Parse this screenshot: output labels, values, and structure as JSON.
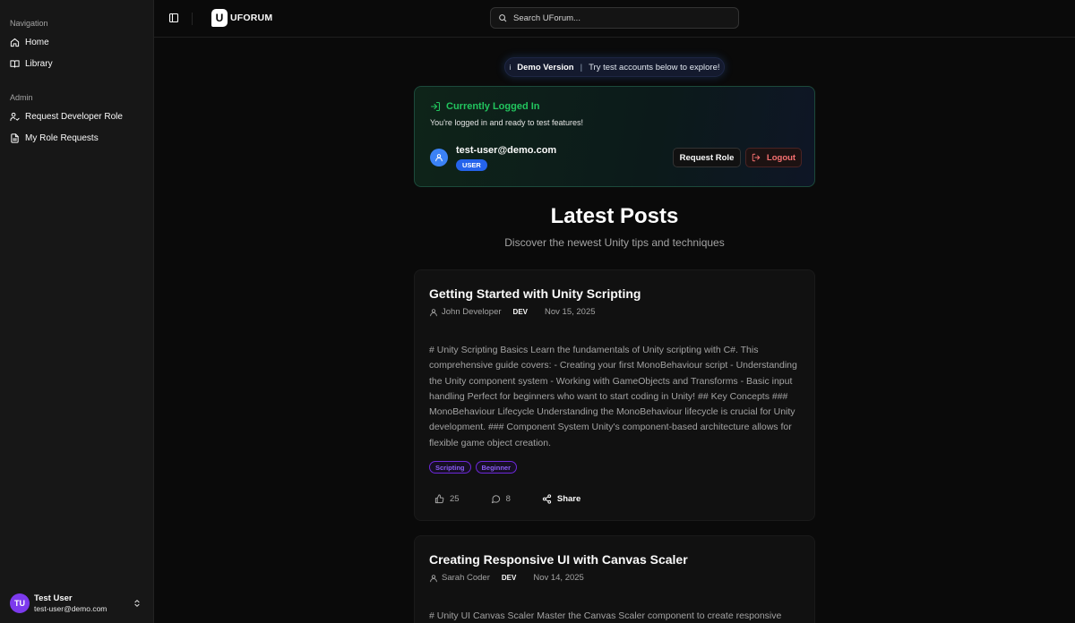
{
  "sidebar": {
    "nav_title": "Navigation",
    "nav_items": [
      {
        "label": "Home",
        "icon": "home-icon"
      },
      {
        "label": "Library",
        "icon": "book-icon"
      }
    ],
    "admin_title": "Admin",
    "admin_items": [
      {
        "label": "Request Developer Role",
        "icon": "user-check-icon"
      },
      {
        "label": "My Role Requests",
        "icon": "document-icon"
      }
    ],
    "user": {
      "initials": "TU",
      "name": "Test User",
      "email": "test-user@demo.com"
    }
  },
  "topbar": {
    "logo_mark": "U",
    "logo_text": "UFORUM",
    "search_placeholder": "Search UForum..."
  },
  "demo_banner": {
    "icon": "i",
    "title": "Demo Version",
    "separator": "|",
    "text": "Try test accounts below to explore!"
  },
  "login_card": {
    "title": "Currently Logged In",
    "subtitle": "You're logged in and ready to test features!",
    "email": "test-user@demo.com",
    "role": "USER",
    "request_role_label": "Request Role",
    "logout_label": "Logout",
    "colors": {
      "accent": "#22c55e",
      "logout": "#f87171",
      "badge": "#2563eb"
    }
  },
  "posts_section": {
    "title": "Latest Posts",
    "subtitle": "Discover the newest Unity tips and techniques"
  },
  "posts": [
    {
      "title": "Getting Started with Unity Scripting",
      "author": "John Developer",
      "author_role": "DEV",
      "date": "Nov 15, 2025",
      "body": "# Unity Scripting Basics Learn the fundamentals of Unity scripting with C#. This comprehensive guide covers: - Creating your first MonoBehaviour script - Understanding the Unity component system - Working with GameObjects and Transforms - Basic input handling Perfect for beginners who want to start coding in Unity! ## Key Concepts ### MonoBehaviour Lifecycle Understanding the MonoBehaviour lifecycle is crucial for Unity development. ### Component System Unity's component-based architecture allows for flexible game object creation.",
      "tags": [
        "Scripting",
        "Beginner"
      ],
      "likes": "25",
      "comments": "8",
      "share_label": "Share"
    },
    {
      "title": "Creating Responsive UI with Canvas Scaler",
      "author": "Sarah Coder",
      "author_role": "DEV",
      "date": "Nov 14, 2025",
      "body": "# Unity UI Canvas Scaler Master the Canvas Scaler component to create responsive"
    }
  ]
}
